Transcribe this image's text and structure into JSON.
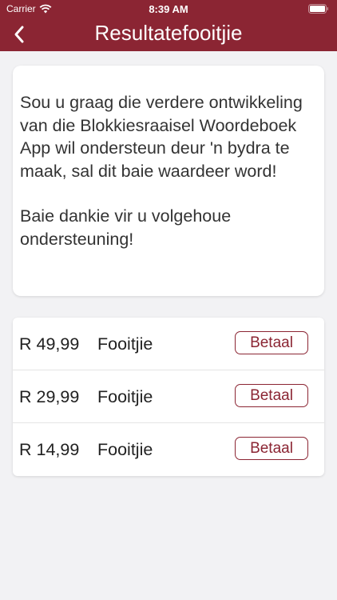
{
  "status_bar": {
    "carrier": "Carrier",
    "time": "8:39 AM"
  },
  "nav": {
    "title": "Resultatefooitjie",
    "back_icon": "chevron-left-icon"
  },
  "message": {
    "paragraph_1": "Sou u graag die verdere ontwikkeling van die Blokkiesraaisel Woordeboek App wil ondersteun deur 'n bydra te maak, sal dit baie waardeer word!",
    "paragraph_2": "Baie dankie vir u volgehoue ondersteuning!"
  },
  "tips": [
    {
      "price": "R 49,99",
      "label": "Fooitjie",
      "button": "Betaal"
    },
    {
      "price": "R 29,99",
      "label": "Fooitjie",
      "button": "Betaal"
    },
    {
      "price": "R 14,99",
      "label": "Fooitjie",
      "button": "Betaal"
    }
  ],
  "colors": {
    "accent": "#8b2533",
    "background": "#f2f2f4",
    "card": "#ffffff"
  }
}
